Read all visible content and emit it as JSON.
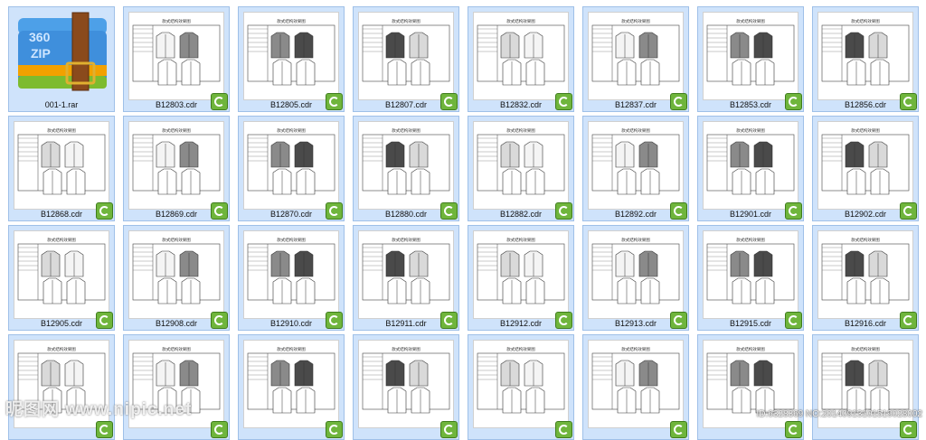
{
  "archive": {
    "name": "001-1.rar",
    "icon": "360zip-archive-icon",
    "icon_text": "360 ZIP"
  },
  "sheet_title": "款式结构效果图",
  "badge_icon": "coreldraw-icon",
  "files": [
    "B12803.cdr",
    "B12805.cdr",
    "B12807.cdr",
    "B12832.cdr",
    "B12837.cdr",
    "B12853.cdr",
    "B12856.cdr",
    "B12868.cdr",
    "B12869.cdr",
    "B12870.cdr",
    "B12880.cdr",
    "B12882.cdr",
    "B12892.cdr",
    "B12901.cdr",
    "B12902.cdr",
    "B12905.cdr",
    "B12908.cdr",
    "B12910.cdr",
    "B12911.cdr",
    "B12912.cdr",
    "B12913.cdr",
    "B12915.cdr",
    "B12916.cdr",
    "",
    "",
    "",
    "",
    "",
    "",
    "",
    ""
  ],
  "watermark": {
    "left": "昵图网 www.nipic.net",
    "right": "ID:6328369 NO:20140913101519028002"
  },
  "colors": {
    "tile_bg": "#cfe3fb",
    "tile_border": "#9fc0e8",
    "badge": "#6fb53c"
  }
}
